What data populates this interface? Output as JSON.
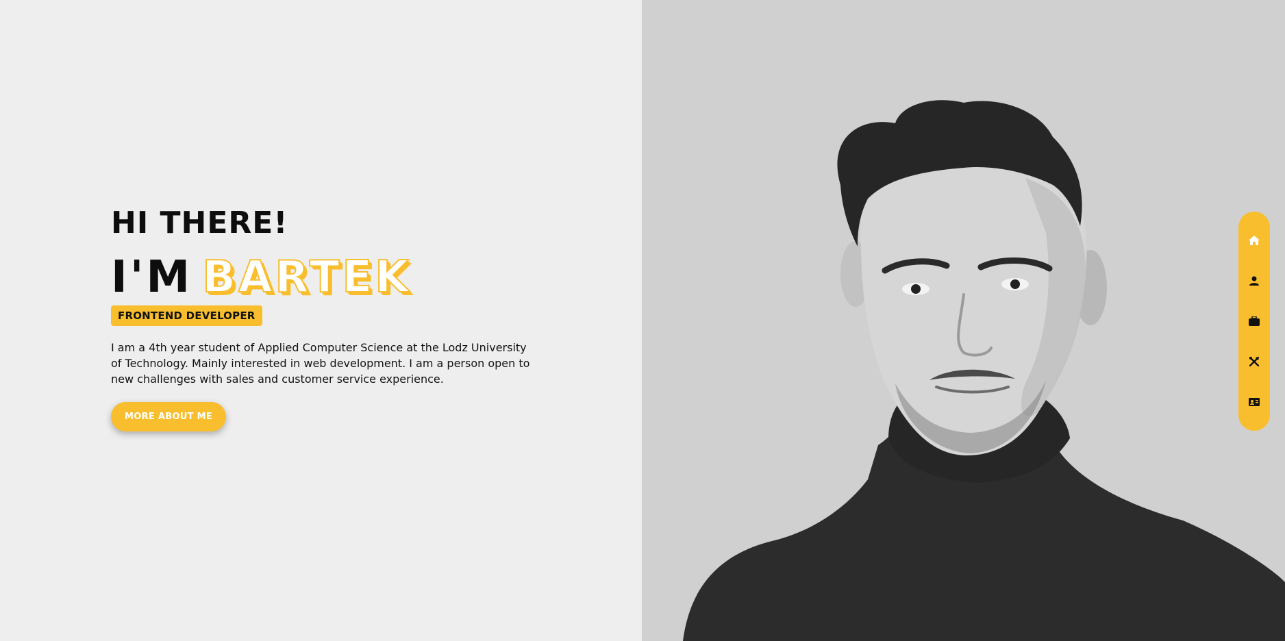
{
  "hero": {
    "greeting": "HI THERE!",
    "name_prefix": "I'M",
    "name": "BARTEK",
    "role": "FRONTEND DEVELOPER",
    "bio": "I am a 4th year student of Applied Computer Science at the Lodz University of Technology. Mainly interested in web development. I am a person open to new challenges with sales and customer service experience.",
    "cta_label": "MORE ABOUT ME"
  },
  "side_nav": {
    "items": [
      {
        "icon": "home-icon"
      },
      {
        "icon": "user-icon"
      },
      {
        "icon": "briefcase-icon"
      },
      {
        "icon": "tools-icon"
      },
      {
        "icon": "contact-card-icon"
      }
    ]
  },
  "colors": {
    "accent": "#f8be2e",
    "left_bg": "#eeeeee",
    "right_bg": "#d0d0d0",
    "text": "#0d0d0d"
  }
}
